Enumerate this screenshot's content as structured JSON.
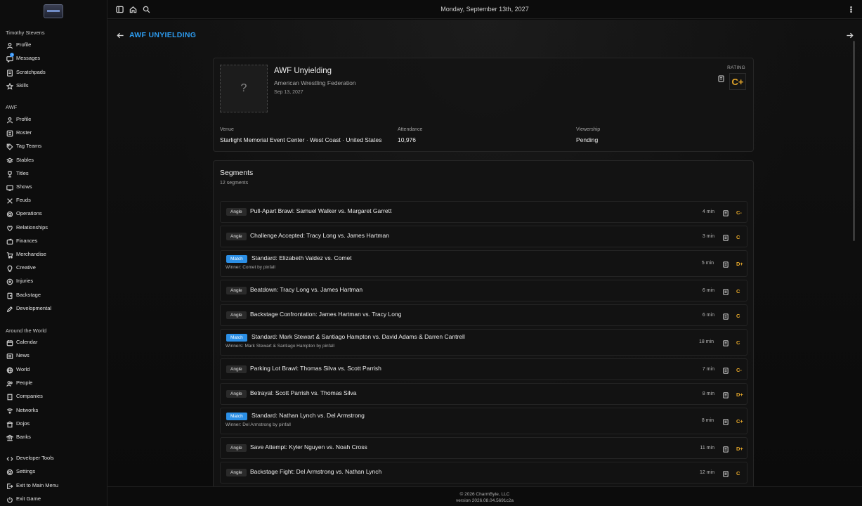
{
  "app": {
    "date": "Monday, September 13th, 2027"
  },
  "sidebar": {
    "user_section": "Timothy Stevens",
    "user_items": [
      {
        "label": "Profile",
        "icon": "user-icon"
      },
      {
        "label": "Messages",
        "icon": "message-icon",
        "badge": "3"
      },
      {
        "label": "Scratchpads",
        "icon": "note-icon"
      },
      {
        "label": "Skills",
        "icon": "star-icon"
      }
    ],
    "org_section": "AWF",
    "org_items": [
      {
        "label": "Profile",
        "icon": "user-icon"
      },
      {
        "label": "Roster",
        "icon": "roster-icon"
      },
      {
        "label": "Tag Teams",
        "icon": "tag-icon"
      },
      {
        "label": "Stables",
        "icon": "stack-icon"
      },
      {
        "label": "Titles",
        "icon": "trophy-icon"
      },
      {
        "label": "Shows",
        "icon": "tv-icon"
      },
      {
        "label": "Feuds",
        "icon": "feud-icon"
      },
      {
        "label": "Operations",
        "icon": "gear-icon"
      },
      {
        "label": "Relationships",
        "icon": "heart-icon"
      },
      {
        "label": "Finances",
        "icon": "wallet-icon"
      },
      {
        "label": "Merchandise",
        "icon": "cart-icon"
      },
      {
        "label": "Creative",
        "icon": "lightbulb-icon"
      },
      {
        "label": "Injuries",
        "icon": "medical-icon"
      },
      {
        "label": "Backstage",
        "icon": "door-icon"
      },
      {
        "label": "Developmental",
        "icon": "pencil-icon"
      }
    ],
    "world_section": "Around the World",
    "world_items": [
      {
        "label": "Calendar",
        "icon": "calendar-icon"
      },
      {
        "label": "News",
        "icon": "newspaper-icon"
      },
      {
        "label": "World",
        "icon": "globe-icon"
      },
      {
        "label": "People",
        "icon": "people-icon"
      },
      {
        "label": "Companies",
        "icon": "building-icon"
      },
      {
        "label": "Networks",
        "icon": "network-icon"
      },
      {
        "label": "Dojos",
        "icon": "dojo-icon"
      },
      {
        "label": "Banks",
        "icon": "bank-icon"
      }
    ],
    "system_items": [
      {
        "label": "Developer Tools",
        "icon": "code-icon"
      },
      {
        "label": "Settings",
        "icon": "gear-icon"
      },
      {
        "label": "Exit to Main Menu",
        "icon": "exit-icon"
      },
      {
        "label": "Exit Game",
        "icon": "power-icon"
      }
    ]
  },
  "page": {
    "title": "AWF UNYIELDING",
    "show": {
      "poster_placeholder": "?",
      "name": "AWF Unyielding",
      "federation": "American Wrestling Federation",
      "date": "Sep 13, 2027",
      "rating_label": "RATING",
      "rating": "C+"
    },
    "stats": [
      {
        "label": "Venue",
        "value": "Starlight Memorial Event Center · West Coast · United States"
      },
      {
        "label": "Attendance",
        "value": "10,976"
      },
      {
        "label": "Viewership",
        "value": "Pending"
      }
    ],
    "segments": {
      "title": "Segments",
      "count": "12 segments",
      "items": [
        {
          "type": "Angle",
          "name": "Pull-Apart Brawl: Samuel Walker vs. Margaret Garrett",
          "duration": "4 min",
          "grade": "C-"
        },
        {
          "type": "Angle",
          "name": "Challenge Accepted: Tracy Long vs. James Hartman",
          "duration": "3 min",
          "grade": "C"
        },
        {
          "type": "Match",
          "name": "Standard: Elizabeth Valdez vs. Comet",
          "sub": "Winner: Comet by pinfall",
          "duration": "5 min",
          "grade": "D+"
        },
        {
          "type": "Angle",
          "name": "Beatdown: Tracy Long vs. James Hartman",
          "duration": "6 min",
          "grade": "C"
        },
        {
          "type": "Angle",
          "name": "Backstage Confrontation: James Hartman vs. Tracy Long",
          "duration": "6 min",
          "grade": "C"
        },
        {
          "type": "Match",
          "name": "Standard: Mark Stewart & Santiago Hampton vs. David Adams & Darren Cantrell",
          "sub": "Winners: Mark Stewart & Santiago Hampton by pinfall",
          "duration": "18 min",
          "grade": "C"
        },
        {
          "type": "Angle",
          "name": "Parking Lot Brawl: Thomas Silva vs. Scott Parrish",
          "duration": "7 min",
          "grade": "C-"
        },
        {
          "type": "Angle",
          "name": "Betrayal: Scott Parrish vs. Thomas Silva",
          "duration": "8 min",
          "grade": "D+"
        },
        {
          "type": "Match",
          "name": "Standard: Nathan Lynch vs. Del Armstrong",
          "sub": "Winner: Del Armstrong by pinfall",
          "duration": "8 min",
          "grade": "C+"
        },
        {
          "type": "Angle",
          "name": "Save Attempt: Kyler Nguyen vs. Noah Cross",
          "duration": "11 min",
          "grade": "D+"
        },
        {
          "type": "Angle",
          "name": "Backstage Fight: Del Armstrong vs. Nathan Lynch",
          "duration": "12 min",
          "grade": "C"
        }
      ]
    }
  },
  "footer": {
    "copyright": "© 2026 CharmByte, LLC",
    "version": "version 2026.08.04.5691c2a"
  },
  "colors": {
    "accent": "#2d9cf0",
    "grade": "#e8a92a",
    "match_tag": "#2b8fe6"
  }
}
